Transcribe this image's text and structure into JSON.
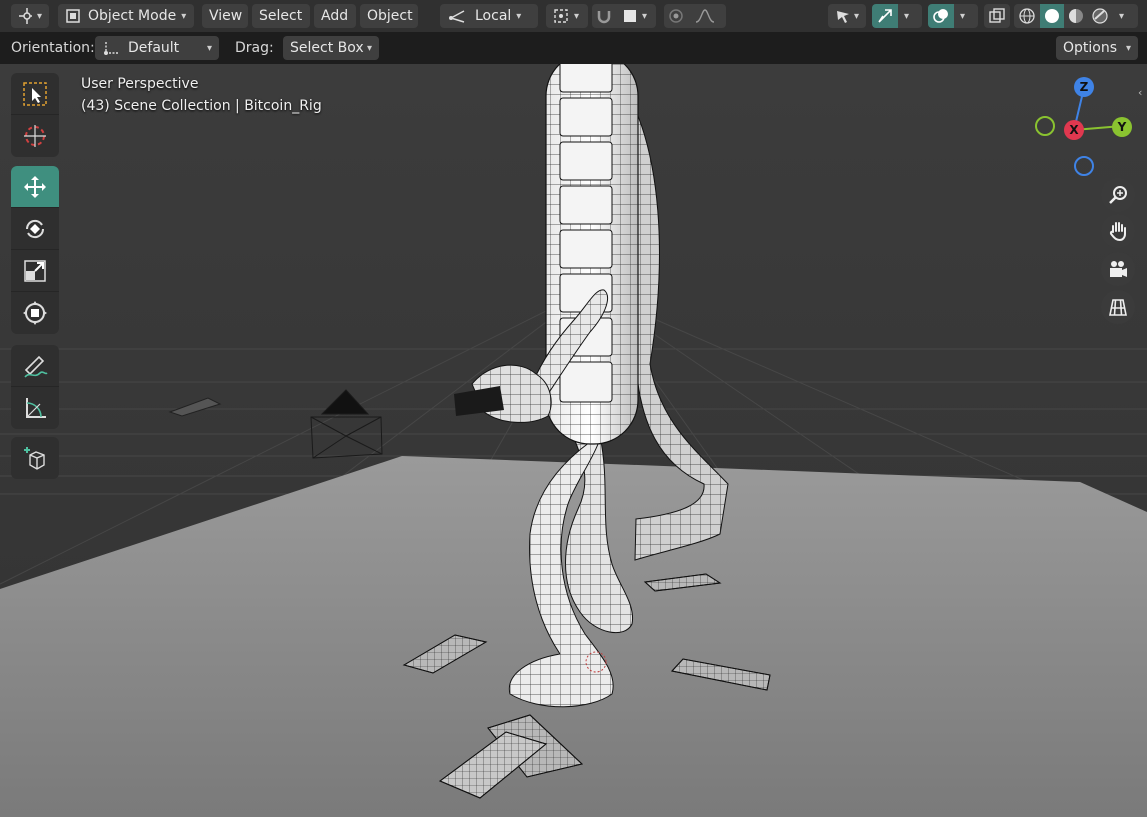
{
  "header": {
    "mode": "Object Mode",
    "menus": [
      "View",
      "Select",
      "Add",
      "Object"
    ],
    "transform_orientation": "Local"
  },
  "tool_header": {
    "orientation_label": "Orientation:",
    "orientation_value": "Default",
    "drag_label": "Drag:",
    "drag_value": "Select Box",
    "options_label": "Options"
  },
  "viewport": {
    "view_name": "User Perspective",
    "collection_info": "(43) Scene Collection | Bitcoin_Rig"
  },
  "gizmo": {
    "x_label": "X",
    "y_label": "Y",
    "z_label": "Z",
    "x_color": "#e0384f",
    "y_color": "#8ac330",
    "z_color": "#3f83e6"
  },
  "colors": {
    "accent": "#3f8f7f",
    "header_bg": "#303030",
    "button_bg": "#3f3f3f"
  },
  "toolbar_icons": [
    "select-box-icon",
    "cursor-icon",
    "move-icon",
    "rotate-icon",
    "scale-icon",
    "transform-icon",
    "annotate-icon",
    "measure-icon",
    "add-cube-icon"
  ],
  "nav_icons": [
    "zoom-icon",
    "pan-hand-icon",
    "camera-icon",
    "grid-view-icon"
  ]
}
